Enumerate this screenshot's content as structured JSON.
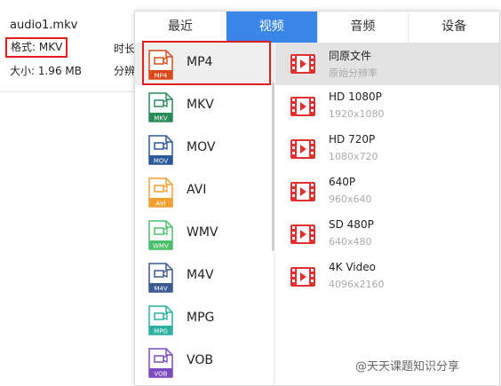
{
  "file": {
    "name": "audio1.mkv",
    "format": "格式: MKV",
    "size": "大小: 1.96 MB",
    "duration_label": "时长",
    "resolution_label": "分辨率"
  },
  "tabs": [
    {
      "label": "最近",
      "active": false
    },
    {
      "label": "视频",
      "active": true
    },
    {
      "label": "音频",
      "active": false
    },
    {
      "label": "设备",
      "active": false
    }
  ],
  "formats": [
    {
      "label": "MP4",
      "icon": "mp4-file-icon",
      "color": "#d84a1b",
      "selected": true
    },
    {
      "label": "MKV",
      "icon": "mkv-file-icon",
      "color": "#2a8a5a",
      "selected": false
    },
    {
      "label": "MOV",
      "icon": "mov-file-icon",
      "color": "#2a5a9a",
      "selected": false
    },
    {
      "label": "AVI",
      "icon": "avi-file-icon",
      "color": "#f0a030",
      "selected": false
    },
    {
      "label": "WMV",
      "icon": "wmv-file-icon",
      "color": "#4cbf6a",
      "selected": false
    },
    {
      "label": "M4V",
      "icon": "m4v-file-icon",
      "color": "#3a5a90",
      "selected": false
    },
    {
      "label": "MPG",
      "icon": "mpg-file-icon",
      "color": "#2ab0a0",
      "selected": false
    },
    {
      "label": "VOB",
      "icon": "vob-file-icon",
      "color": "#7a4ac0",
      "selected": false
    }
  ],
  "resolutions": [
    {
      "title": "同原文件",
      "sub": "原始分辨率",
      "selected": true
    },
    {
      "title": "HD 1080P",
      "sub": "1920x1080",
      "selected": false
    },
    {
      "title": "HD 720P",
      "sub": "1080x720",
      "selected": false
    },
    {
      "title": "640P",
      "sub": "960x640",
      "selected": false
    },
    {
      "title": "SD 480P",
      "sub": "640x480",
      "selected": false
    },
    {
      "title": "4K Video",
      "sub": "4096x2160",
      "selected": false
    }
  ],
  "colors": {
    "accent": "#3a86e8",
    "highlight": "#e02020",
    "video_icon": "#e03030"
  },
  "watermark": "@天天课题知识分享"
}
